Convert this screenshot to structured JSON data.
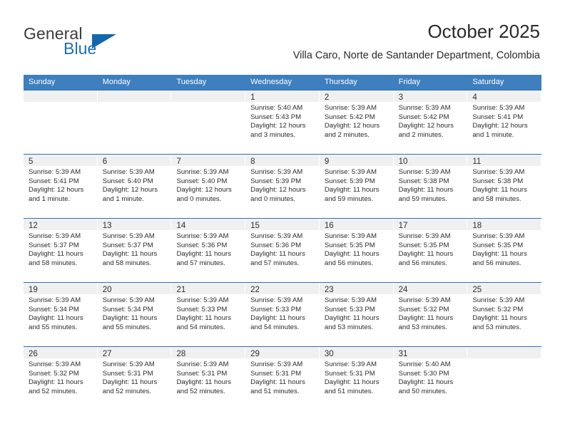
{
  "brand": {
    "name_part1": "General",
    "name_part2": "Blue",
    "triangle_color": "#1267ad",
    "blue_color": "#1c6fb5"
  },
  "header": {
    "title": "October 2025",
    "subtitle": "Villa Caro, Norte de Santander Department, Colombia"
  },
  "theme": {
    "header_bg": "#3d7fbf",
    "header_text": "#ffffff",
    "daynum_band_bg": "#f0f0f0",
    "week_divider": "#2f6fae",
    "body_text": "#2c2c2c"
  },
  "calendar": {
    "day_names": [
      "Sunday",
      "Monday",
      "Tuesday",
      "Wednesday",
      "Thursday",
      "Friday",
      "Saturday"
    ],
    "weeks": [
      [
        {
          "day": "",
          "sunrise": "",
          "sunset": "",
          "daylight1": "",
          "daylight2": ""
        },
        {
          "day": "",
          "sunrise": "",
          "sunset": "",
          "daylight1": "",
          "daylight2": ""
        },
        {
          "day": "",
          "sunrise": "",
          "sunset": "",
          "daylight1": "",
          "daylight2": ""
        },
        {
          "day": "1",
          "sunrise": "Sunrise: 5:40 AM",
          "sunset": "Sunset: 5:43 PM",
          "daylight1": "Daylight: 12 hours",
          "daylight2": "and 3 minutes."
        },
        {
          "day": "2",
          "sunrise": "Sunrise: 5:39 AM",
          "sunset": "Sunset: 5:42 PM",
          "daylight1": "Daylight: 12 hours",
          "daylight2": "and 2 minutes."
        },
        {
          "day": "3",
          "sunrise": "Sunrise: 5:39 AM",
          "sunset": "Sunset: 5:42 PM",
          "daylight1": "Daylight: 12 hours",
          "daylight2": "and 2 minutes."
        },
        {
          "day": "4",
          "sunrise": "Sunrise: 5:39 AM",
          "sunset": "Sunset: 5:41 PM",
          "daylight1": "Daylight: 12 hours",
          "daylight2": "and 1 minute."
        }
      ],
      [
        {
          "day": "5",
          "sunrise": "Sunrise: 5:39 AM",
          "sunset": "Sunset: 5:41 PM",
          "daylight1": "Daylight: 12 hours",
          "daylight2": "and 1 minute."
        },
        {
          "day": "6",
          "sunrise": "Sunrise: 5:39 AM",
          "sunset": "Sunset: 5:40 PM",
          "daylight1": "Daylight: 12 hours",
          "daylight2": "and 1 minute."
        },
        {
          "day": "7",
          "sunrise": "Sunrise: 5:39 AM",
          "sunset": "Sunset: 5:40 PM",
          "daylight1": "Daylight: 12 hours",
          "daylight2": "and 0 minutes."
        },
        {
          "day": "8",
          "sunrise": "Sunrise: 5:39 AM",
          "sunset": "Sunset: 5:39 PM",
          "daylight1": "Daylight: 12 hours",
          "daylight2": "and 0 minutes."
        },
        {
          "day": "9",
          "sunrise": "Sunrise: 5:39 AM",
          "sunset": "Sunset: 5:39 PM",
          "daylight1": "Daylight: 11 hours",
          "daylight2": "and 59 minutes."
        },
        {
          "day": "10",
          "sunrise": "Sunrise: 5:39 AM",
          "sunset": "Sunset: 5:38 PM",
          "daylight1": "Daylight: 11 hours",
          "daylight2": "and 59 minutes."
        },
        {
          "day": "11",
          "sunrise": "Sunrise: 5:39 AM",
          "sunset": "Sunset: 5:38 PM",
          "daylight1": "Daylight: 11 hours",
          "daylight2": "and 58 minutes."
        }
      ],
      [
        {
          "day": "12",
          "sunrise": "Sunrise: 5:39 AM",
          "sunset": "Sunset: 5:37 PM",
          "daylight1": "Daylight: 11 hours",
          "daylight2": "and 58 minutes."
        },
        {
          "day": "13",
          "sunrise": "Sunrise: 5:39 AM",
          "sunset": "Sunset: 5:37 PM",
          "daylight1": "Daylight: 11 hours",
          "daylight2": "and 58 minutes."
        },
        {
          "day": "14",
          "sunrise": "Sunrise: 5:39 AM",
          "sunset": "Sunset: 5:36 PM",
          "daylight1": "Daylight: 11 hours",
          "daylight2": "and 57 minutes."
        },
        {
          "day": "15",
          "sunrise": "Sunrise: 5:39 AM",
          "sunset": "Sunset: 5:36 PM",
          "daylight1": "Daylight: 11 hours",
          "daylight2": "and 57 minutes."
        },
        {
          "day": "16",
          "sunrise": "Sunrise: 5:39 AM",
          "sunset": "Sunset: 5:35 PM",
          "daylight1": "Daylight: 11 hours",
          "daylight2": "and 56 minutes."
        },
        {
          "day": "17",
          "sunrise": "Sunrise: 5:39 AM",
          "sunset": "Sunset: 5:35 PM",
          "daylight1": "Daylight: 11 hours",
          "daylight2": "and 56 minutes."
        },
        {
          "day": "18",
          "sunrise": "Sunrise: 5:39 AM",
          "sunset": "Sunset: 5:35 PM",
          "daylight1": "Daylight: 11 hours",
          "daylight2": "and 56 minutes."
        }
      ],
      [
        {
          "day": "19",
          "sunrise": "Sunrise: 5:39 AM",
          "sunset": "Sunset: 5:34 PM",
          "daylight1": "Daylight: 11 hours",
          "daylight2": "and 55 minutes."
        },
        {
          "day": "20",
          "sunrise": "Sunrise: 5:39 AM",
          "sunset": "Sunset: 5:34 PM",
          "daylight1": "Daylight: 11 hours",
          "daylight2": "and 55 minutes."
        },
        {
          "day": "21",
          "sunrise": "Sunrise: 5:39 AM",
          "sunset": "Sunset: 5:33 PM",
          "daylight1": "Daylight: 11 hours",
          "daylight2": "and 54 minutes."
        },
        {
          "day": "22",
          "sunrise": "Sunrise: 5:39 AM",
          "sunset": "Sunset: 5:33 PM",
          "daylight1": "Daylight: 11 hours",
          "daylight2": "and 54 minutes."
        },
        {
          "day": "23",
          "sunrise": "Sunrise: 5:39 AM",
          "sunset": "Sunset: 5:33 PM",
          "daylight1": "Daylight: 11 hours",
          "daylight2": "and 53 minutes."
        },
        {
          "day": "24",
          "sunrise": "Sunrise: 5:39 AM",
          "sunset": "Sunset: 5:32 PM",
          "daylight1": "Daylight: 11 hours",
          "daylight2": "and 53 minutes."
        },
        {
          "day": "25",
          "sunrise": "Sunrise: 5:39 AM",
          "sunset": "Sunset: 5:32 PM",
          "daylight1": "Daylight: 11 hours",
          "daylight2": "and 53 minutes."
        }
      ],
      [
        {
          "day": "26",
          "sunrise": "Sunrise: 5:39 AM",
          "sunset": "Sunset: 5:32 PM",
          "daylight1": "Daylight: 11 hours",
          "daylight2": "and 52 minutes."
        },
        {
          "day": "27",
          "sunrise": "Sunrise: 5:39 AM",
          "sunset": "Sunset: 5:31 PM",
          "daylight1": "Daylight: 11 hours",
          "daylight2": "and 52 minutes."
        },
        {
          "day": "28",
          "sunrise": "Sunrise: 5:39 AM",
          "sunset": "Sunset: 5:31 PM",
          "daylight1": "Daylight: 11 hours",
          "daylight2": "and 52 minutes."
        },
        {
          "day": "29",
          "sunrise": "Sunrise: 5:39 AM",
          "sunset": "Sunset: 5:31 PM",
          "daylight1": "Daylight: 11 hours",
          "daylight2": "and 51 minutes."
        },
        {
          "day": "30",
          "sunrise": "Sunrise: 5:39 AM",
          "sunset": "Sunset: 5:31 PM",
          "daylight1": "Daylight: 11 hours",
          "daylight2": "and 51 minutes."
        },
        {
          "day": "31",
          "sunrise": "Sunrise: 5:40 AM",
          "sunset": "Sunset: 5:30 PM",
          "daylight1": "Daylight: 11 hours",
          "daylight2": "and 50 minutes."
        },
        {
          "day": "",
          "sunrise": "",
          "sunset": "",
          "daylight1": "",
          "daylight2": ""
        }
      ]
    ]
  }
}
